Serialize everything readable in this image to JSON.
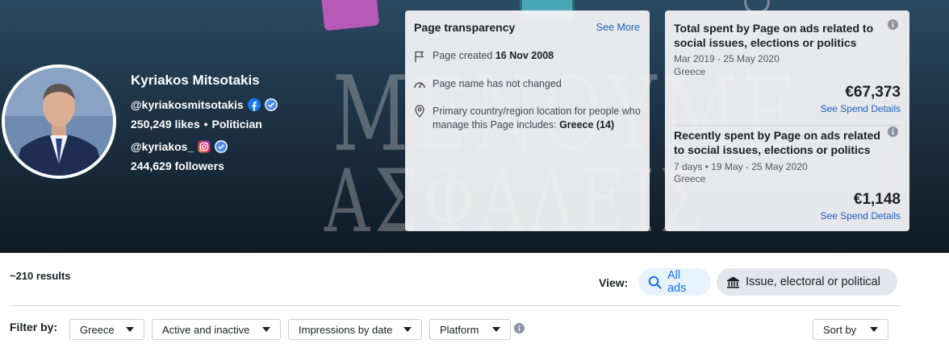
{
  "profile": {
    "name": "Kyriakos Mitsotakis",
    "facebook_handle": "@kyriakosmitsotakis",
    "likes": "250,249 likes",
    "category": "Politician",
    "instagram_handle": "@kyriakos_",
    "followers": "244,629 followers"
  },
  "banner": {
    "watermark_line1": "ΜΕΝΟΥΜΕ",
    "watermark_line2": "ΑΣΦΑΛΕΙΣ"
  },
  "transparency": {
    "title": "Page transparency",
    "see_more": "See More",
    "created_label": "Page created",
    "created_date": "16 Nov 2008",
    "name_changes": "Page name has not changed",
    "location_text": "Primary country/region location for people who manage this Page includes:",
    "location_value": "Greece (14)"
  },
  "spend": {
    "total": {
      "title": "Total spent by Page on ads related to social issues, elections or politics",
      "range": "Mar 2019 - 25 May 2020",
      "country": "Greece",
      "amount": "€67,373",
      "link": "See Spend Details"
    },
    "recent": {
      "title": "Recently spent by Page on ads related to social issues, elections or politics",
      "range": "7 days • 19 May - 25 May 2020",
      "country": "Greece",
      "amount": "€1,148",
      "link": "See Spend Details"
    }
  },
  "results": {
    "count": "~210 results"
  },
  "view": {
    "label": "View:",
    "all_ads": "All ads",
    "issue": "Issue, electoral or political"
  },
  "filters": {
    "label": "Filter by:",
    "country": "Greece",
    "status": "Active and inactive",
    "impressions": "Impressions by date",
    "platform": "Platform",
    "sort": "Sort by"
  },
  "colors": {
    "link_blue": "#1d5fbf",
    "facebook_blue": "#1877f2",
    "verified_blue": "#4d8de8",
    "pill_active_bg": "#e7f3ff"
  },
  "icons": [
    "facebook-icon",
    "verified-icon",
    "instagram-icon",
    "flag-icon",
    "gauge-icon",
    "location-pin-icon",
    "info-icon",
    "search-icon",
    "bank-icon",
    "chevron-down-icon"
  ]
}
